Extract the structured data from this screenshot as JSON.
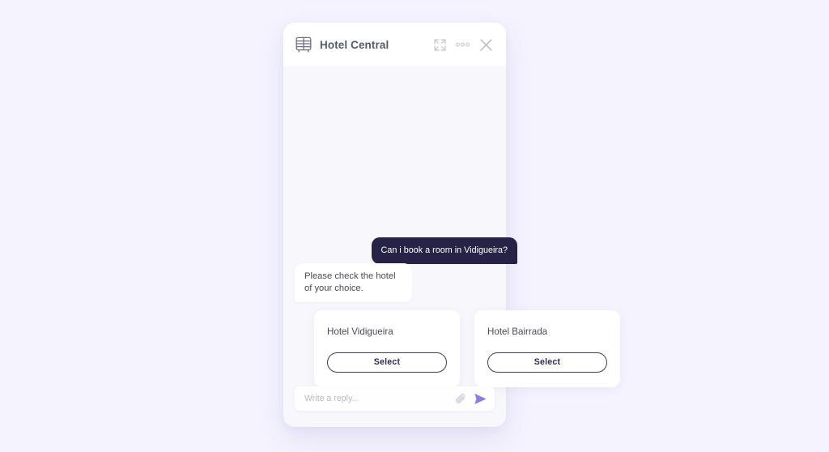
{
  "app": {
    "background_color": "#f4f3fe",
    "panel_background": "#f7f7fc"
  },
  "header": {
    "title": "Hotel Central",
    "logo_icon": "hotel-beds-icon",
    "actions": [
      {
        "name": "expand-icon",
        "label": "Expand"
      },
      {
        "name": "more-options-icon",
        "label": "More options"
      },
      {
        "name": "close-icon",
        "label": "Close"
      }
    ]
  },
  "conversation": {
    "messages": [
      {
        "id": "user-msg",
        "sender": "user",
        "text": "Can i book a room in  Vidigueira?",
        "bubble_color": "#262347",
        "text_color": "#ffffff"
      },
      {
        "id": "bot-msg",
        "sender": "bot",
        "text": "Please check the hotel of your choice.",
        "bubble_color": "#ffffff",
        "text_color": "#4a4a55"
      }
    ],
    "option_cards": [
      {
        "name": "Hotel Vidigueira",
        "button_label": "Select"
      },
      {
        "name": "Hotel Bairrada",
        "button_label": "Select"
      }
    ]
  },
  "composer": {
    "placeholder": "Write a reply...",
    "value": "",
    "attach_icon": "paperclip-icon",
    "send_icon": "send-arrow-icon",
    "send_color": "#8b7ee2"
  }
}
